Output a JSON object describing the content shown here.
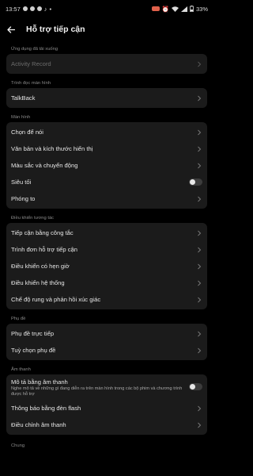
{
  "status_bar": {
    "time": "13:57",
    "battery": "33%"
  },
  "header": {
    "title": "Hỗ trợ tiếp cận"
  },
  "sections": {
    "downloaded": {
      "title": "Ứng dụng đã tải xuống",
      "items": [
        "Activity Record"
      ]
    },
    "screen_reader": {
      "title": "Trình đọc màn hình",
      "items": [
        "TalkBack"
      ]
    },
    "display": {
      "title": "Màn hình",
      "items": [
        "Chọn để nói",
        "Văn bản và kích thước hiển thị",
        "Màu sắc và chuyển động",
        "Siêu tối",
        "Phóng to"
      ]
    },
    "interaction": {
      "title": "Điều khiển tương tác",
      "items": [
        "Tiếp cận bằng công tắc",
        "Trình đơn hỗ trợ tiếp cận",
        "Điều khiển có hẹn giờ",
        "Điều khiển hệ thống",
        "Chế độ rung và phản hồi xúc giác"
      ]
    },
    "captions": {
      "title": "Phụ đề",
      "items": [
        "Phụ đề trực tiếp",
        "Tuỳ chọn phụ đề"
      ]
    },
    "audio": {
      "title": "Âm thanh",
      "audio_description": {
        "label": "Mô tả bằng âm thanh",
        "desc": "Nghe mô tả về những gì đang diễn ra trên màn hình trong các bộ phim và chương trình được hỗ trợ"
      },
      "items": [
        "Thông báo bằng đèn flash",
        "Điều chỉnh âm thanh"
      ]
    },
    "general": {
      "title": "Chung"
    }
  },
  "toggles": {
    "super_dark": false,
    "audio_description": false
  }
}
